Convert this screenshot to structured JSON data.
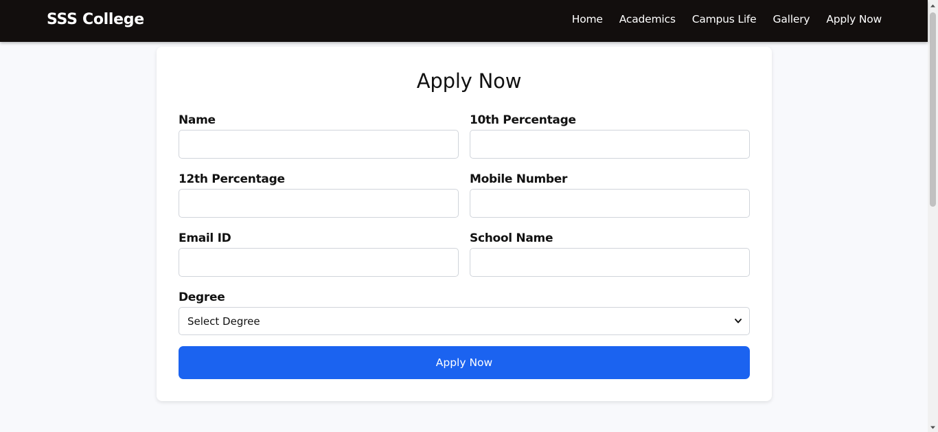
{
  "navbar": {
    "brand": "SSS College",
    "links": [
      "Home",
      "Academics",
      "Campus Life",
      "Gallery",
      "Apply Now"
    ]
  },
  "form": {
    "title": "Apply Now",
    "fields": {
      "name": {
        "label": "Name",
        "value": ""
      },
      "tenth": {
        "label": "10th Percentage",
        "value": ""
      },
      "twelfth": {
        "label": "12th Percentage",
        "value": ""
      },
      "mobile": {
        "label": "Mobile Number",
        "value": ""
      },
      "email": {
        "label": "Email ID",
        "value": ""
      },
      "school": {
        "label": "School Name",
        "value": ""
      }
    },
    "degree": {
      "label": "Degree",
      "selected": "Select Degree"
    },
    "submit_label": "Apply Now"
  },
  "colors": {
    "navbar_bg": "#120e0d",
    "accent": "#1b63f0",
    "page_bg": "#f8f9fc"
  }
}
